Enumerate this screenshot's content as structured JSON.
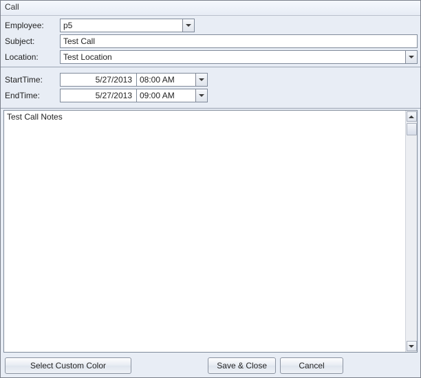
{
  "window": {
    "title": "Call"
  },
  "labels": {
    "employee": "Employee:",
    "subject": "Subject:",
    "location": "Location:",
    "start_time": "StartTime:",
    "end_time": "EndTime:"
  },
  "fields": {
    "employee": "p5",
    "subject": "Test Call",
    "location": "Test Location",
    "start_date": "5/27/2013",
    "start_time": "08:00 AM",
    "end_date": "5/27/2013",
    "end_time": "09:00 AM",
    "notes": "Test Call Notes"
  },
  "buttons": {
    "select_color": "Select Custom Color",
    "save_close": "Save & Close",
    "cancel": "Cancel"
  }
}
